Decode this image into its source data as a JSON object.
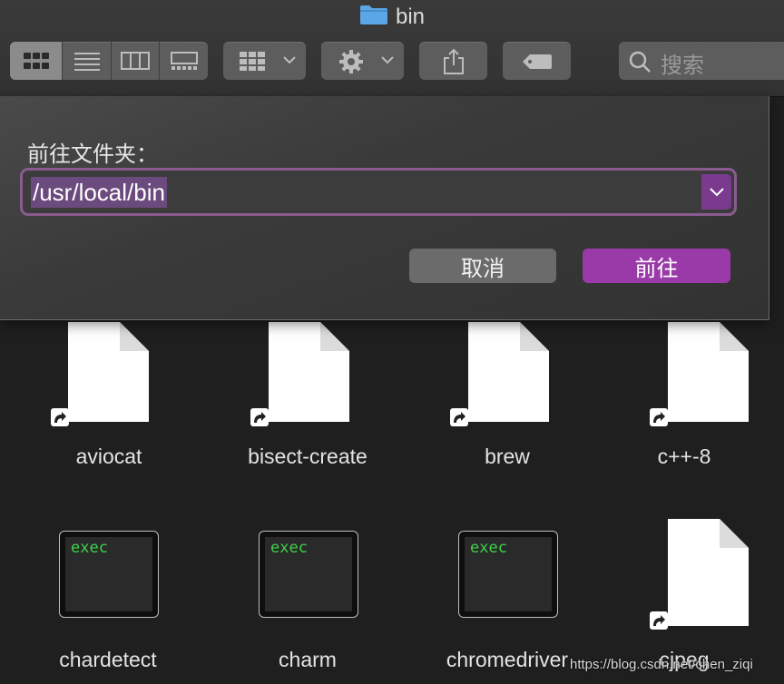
{
  "window": {
    "title": "bin"
  },
  "toolbar": {
    "view_buttons": [
      "icon-view",
      "list-view",
      "column-view",
      "gallery-view"
    ],
    "group_icon": "grid-group-icon",
    "action_icon": "gear-icon",
    "share_icon": "share-icon",
    "tag_icon": "tag-icon",
    "search_placeholder": "搜索"
  },
  "dialog": {
    "label": "前往文件夹：",
    "path_value": "/usr/local/bin",
    "cancel_label": "取消",
    "go_label": "前往"
  },
  "files": [
    {
      "name": "aviocat",
      "kind": "alias"
    },
    {
      "name": "bisect-create",
      "kind": "alias"
    },
    {
      "name": "brew",
      "kind": "alias"
    },
    {
      "name": "c++-8",
      "kind": "alias"
    },
    {
      "name": "chardetect",
      "kind": "exec",
      "badge": "exec"
    },
    {
      "name": "charm",
      "kind": "exec",
      "badge": "exec"
    },
    {
      "name": "chromedriver",
      "kind": "exec",
      "badge": "exec"
    },
    {
      "name": "cjpeg",
      "kind": "alias"
    }
  ],
  "watermark": "https://blog.csdn.net/chen_ziqi",
  "colors": {
    "accent": "#9a3aa8",
    "focus_ring": "#8b5a8f",
    "exec_text": "#3fd14a"
  }
}
